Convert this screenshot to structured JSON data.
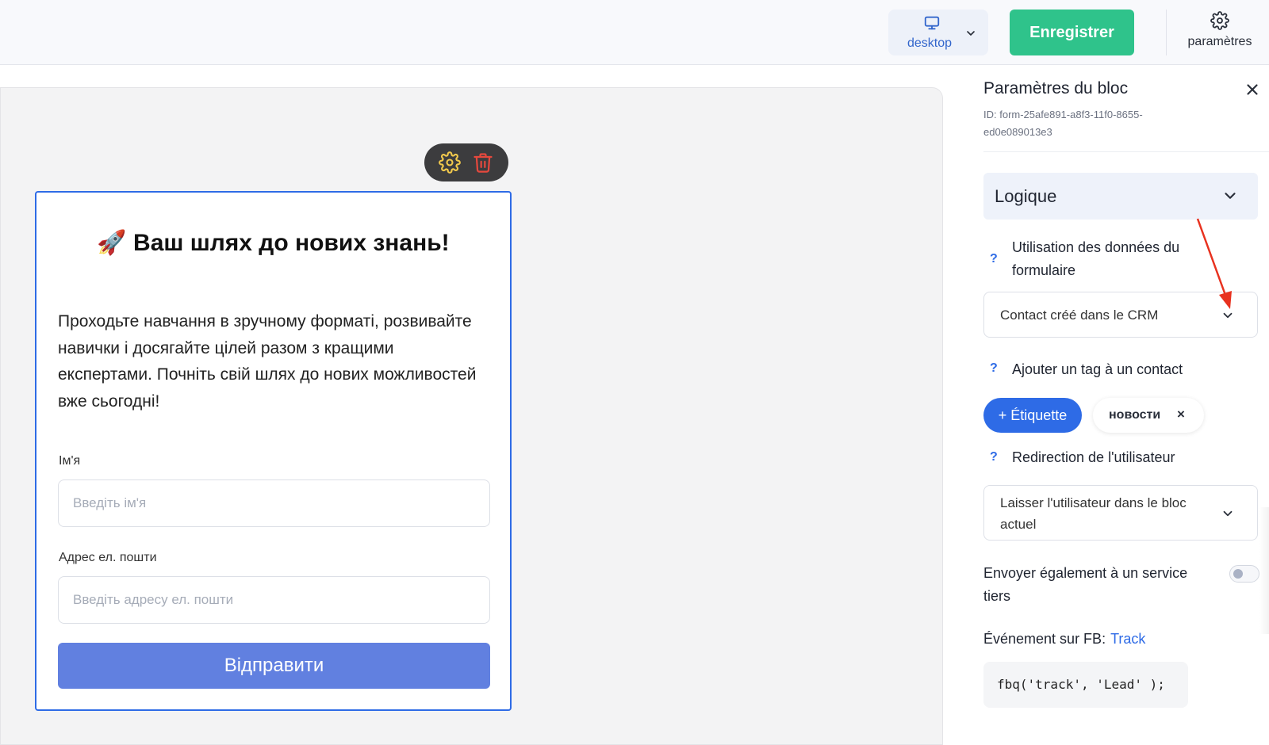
{
  "header": {
    "device": {
      "label": "desktop",
      "icon": "monitor-icon"
    },
    "save_label": "Enregistrer",
    "settings_label": "paramètres"
  },
  "canvas": {
    "form": {
      "title": "🚀 Ваш шлях до нових знань!",
      "description": "Проходьте навчання в зручному форматі, розвивайте навички і досягайте цілей разом з кращими експертами. Почніть свій шлях до нових можливостей вже сьогодні!",
      "name_label": "Ім'я",
      "name_placeholder": "Введіть ім'я",
      "email_label": "Адрес ел. пошти",
      "email_placeholder": "Введіть адресу ел. пошти",
      "submit_label": "Відправити"
    }
  },
  "panel": {
    "title": "Paramètres du bloc",
    "block_id": "ID: form-25afe891-a8f3-11f0-8655-ed0e089013e3",
    "section": "Logique",
    "form_data": {
      "help": "?",
      "label": "Utilisation des données du formulaire",
      "value": "Contact créé dans le CRM"
    },
    "tag": {
      "help": "?",
      "label": "Ajouter un tag à un contact",
      "add_label": "+ Étiquette",
      "tags": [
        "новости"
      ],
      "remove": "×"
    },
    "redirect": {
      "help": "?",
      "label": "Redirection de l'utilisateur",
      "value": "Laisser l'utilisateur dans le bloc actuel"
    },
    "third_party": {
      "label": "Envoyer également à un service tiers",
      "enabled": false
    },
    "fb_event": {
      "label": "Événement sur FB:",
      "value": "Track",
      "code": "fbq('track', 'Lead' );"
    }
  },
  "colors": {
    "accent": "#2e6be6",
    "save": "#2fc38b",
    "submit": "#6180e0",
    "annotation_arrow": "#e8321f"
  }
}
